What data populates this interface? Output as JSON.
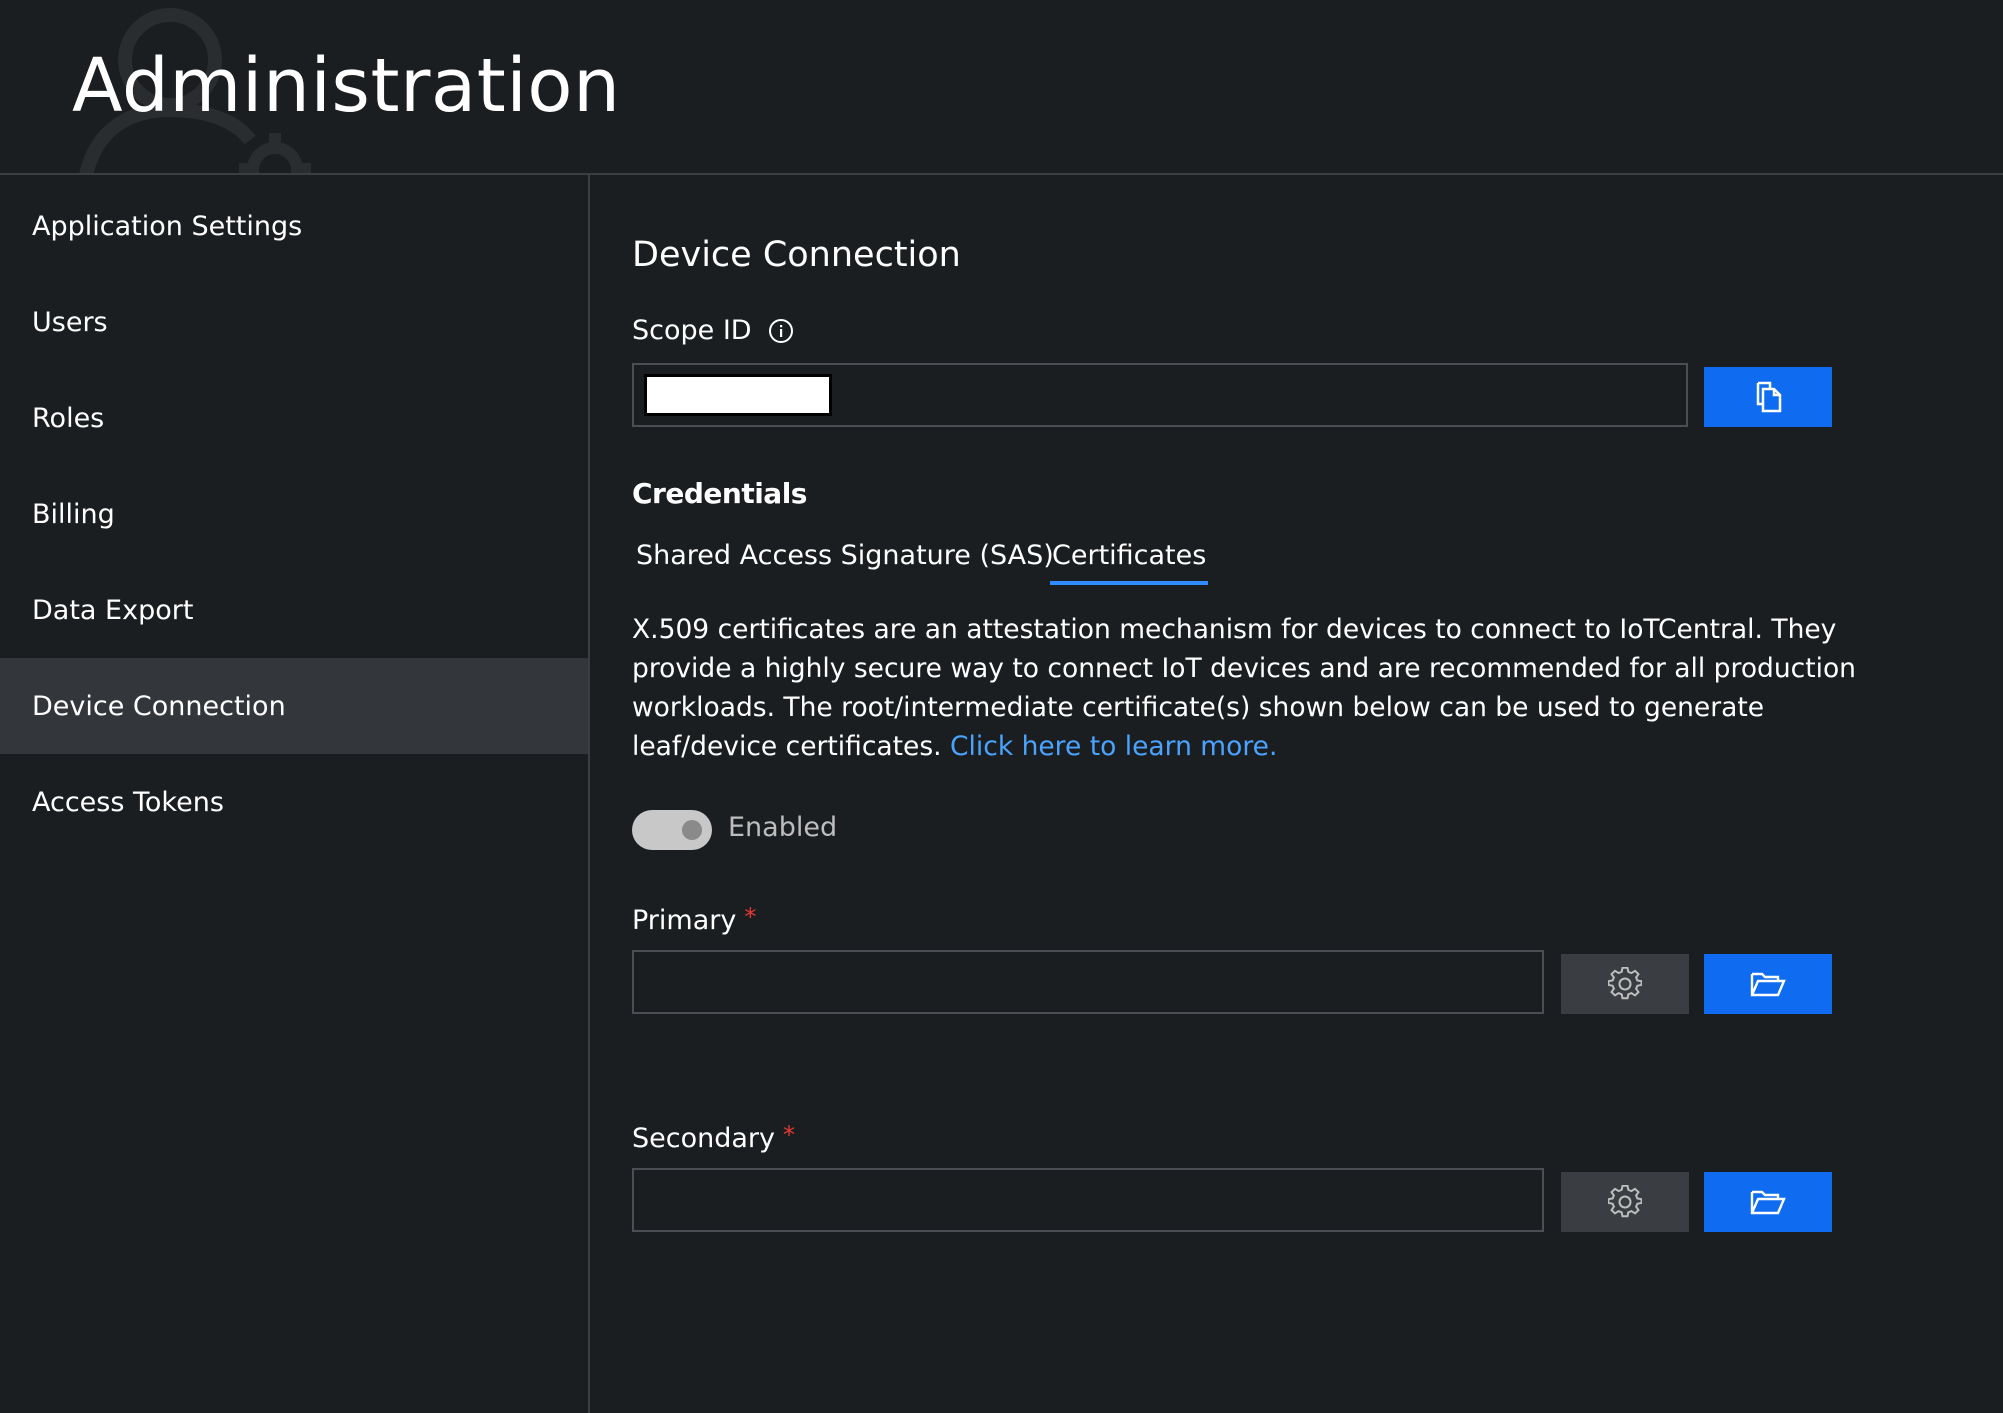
{
  "header": {
    "title": "Administration"
  },
  "sidebar": {
    "items": [
      {
        "label": "Application Settings"
      },
      {
        "label": "Users"
      },
      {
        "label": "Roles"
      },
      {
        "label": "Billing"
      },
      {
        "label": "Data Export"
      },
      {
        "label": "Device Connection",
        "active": true
      },
      {
        "label": "Access Tokens"
      }
    ]
  },
  "main": {
    "title": "Device Connection",
    "scope_id": {
      "label": "Scope ID",
      "info_icon": "info-icon",
      "copy_icon": "copy-icon"
    },
    "credentials": {
      "heading": "Credentials",
      "tabs": [
        {
          "label": "Shared Access Signature (SAS)",
          "active": false
        },
        {
          "label": "Certificates",
          "active": true
        }
      ],
      "description": "X.509 certificates are an attestation mechanism for devices to connect to IoTCentral. They provide a highly secure way to connect IoT devices and are recommended for all production workloads. The root/intermediate certificate(s) shown below can be used to generate leaf/device certificates.",
      "learn_more": "Click here to learn more.",
      "toggle": {
        "label": "Enabled",
        "on": true
      }
    },
    "primary": {
      "label": "Primary",
      "required": "*",
      "value": ""
    },
    "secondary": {
      "label": "Secondary",
      "required": "*",
      "value": ""
    }
  },
  "colors": {
    "background": "#1b1e20",
    "accent": "#0f6cf0",
    "link": "#4aa3ff",
    "required": "#e53935",
    "active_nav": "#33363b"
  }
}
